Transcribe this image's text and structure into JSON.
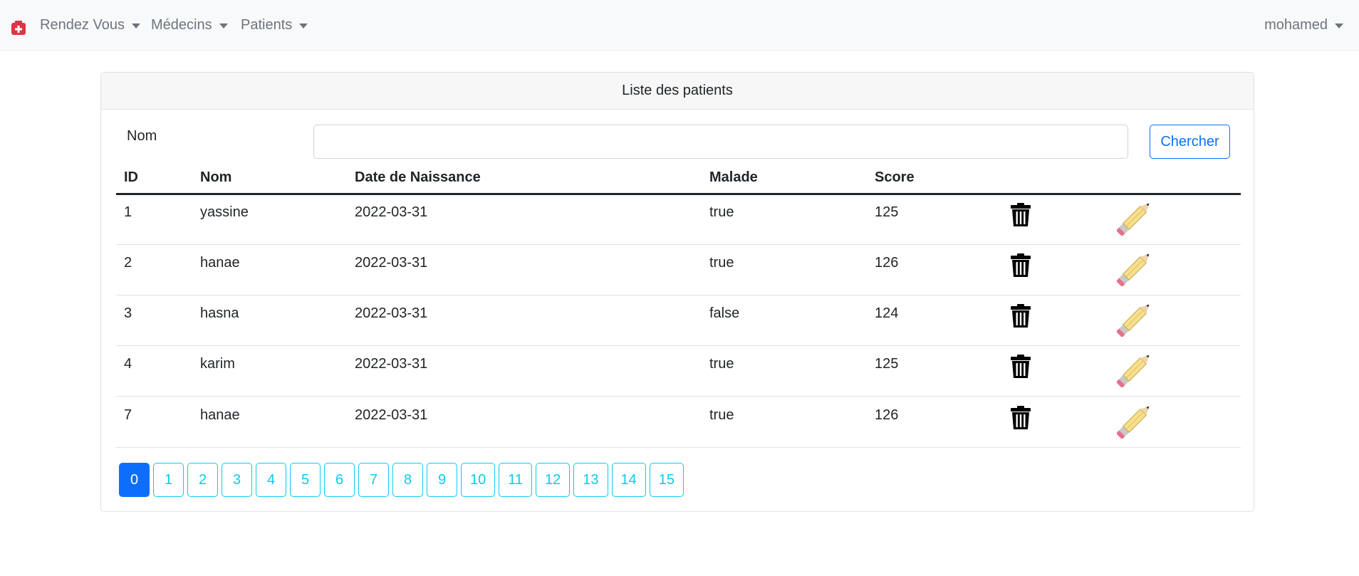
{
  "navbar": {
    "brand_icon": "hospital-icon",
    "items": [
      {
        "label": "Rendez Vous"
      },
      {
        "label": "Médecins"
      },
      {
        "label": "Patients"
      }
    ],
    "user": "mohamed"
  },
  "card": {
    "title": "Liste des patients",
    "search": {
      "label": "Nom",
      "value": "",
      "placeholder": "",
      "button": "Chercher"
    },
    "table": {
      "headers": [
        "ID",
        "Nom",
        "Date de Naissance",
        "Malade",
        "Score"
      ],
      "rows": [
        {
          "id": "1",
          "nom": "yassine",
          "date": "2022-03-31",
          "malade": "true",
          "score": "125"
        },
        {
          "id": "2",
          "nom": "hanae",
          "date": "2022-03-31",
          "malade": "true",
          "score": "126"
        },
        {
          "id": "3",
          "nom": "hasna",
          "date": "2022-03-31",
          "malade": "false",
          "score": "124"
        },
        {
          "id": "4",
          "nom": "karim",
          "date": "2022-03-31",
          "malade": "true",
          "score": "125"
        },
        {
          "id": "7",
          "nom": "hanae",
          "date": "2022-03-31",
          "malade": "true",
          "score": "126"
        }
      ],
      "row_actions": [
        "trash-icon",
        "pencil-icon"
      ]
    },
    "pagination": {
      "pages": [
        "0",
        "1",
        "2",
        "3",
        "4",
        "5",
        "6",
        "7",
        "8",
        "9",
        "10",
        "11",
        "12",
        "13",
        "14",
        "15"
      ],
      "current": "0"
    }
  },
  "colors": {
    "primary": "#0d6efd",
    "info": "#0dcaf0",
    "navbar_bg": "#f8f9fa",
    "brand_red": "#dc3545"
  }
}
